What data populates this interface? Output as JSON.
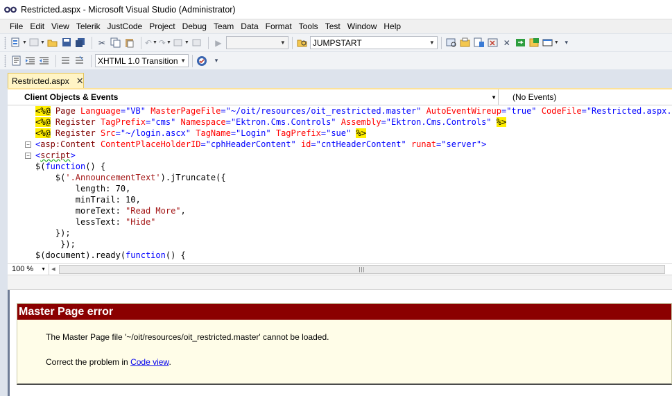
{
  "window": {
    "title": "Restricted.aspx - Microsoft Visual Studio (Administrator)"
  },
  "menu": [
    "File",
    "Edit",
    "View",
    "Telerik",
    "JustCode",
    "Project",
    "Debug",
    "Team",
    "Data",
    "Format",
    "Tools",
    "Test",
    "Window",
    "Help"
  ],
  "toolbar1": {
    "config_combo": "",
    "find_combo": "JUMPSTART",
    "icons": [
      "new-project-icon",
      "add-item-icon",
      "open-file-icon",
      "save-icon",
      "save-all-icon",
      "cut-icon",
      "copy-icon",
      "paste-icon",
      "undo-icon",
      "redo-icon",
      "navigate-back-icon",
      "navigate-forward-icon",
      "start-debugging-icon",
      "find-in-files-icon",
      "solution-explorer-icon",
      "properties-icon",
      "object-browser-icon",
      "toolbox-icon",
      "start-page-icon",
      "extension-manager-icon",
      "command-window-icon"
    ]
  },
  "toolbar2": {
    "schema_combo": "XHTML 1.0 Transition",
    "icons": [
      "format-selection-icon",
      "indent-icon",
      "outdent-icon",
      "comment-icon",
      "uncomment-icon",
      "check-accessibility-icon"
    ]
  },
  "tab": {
    "label": "Restricted.aspx"
  },
  "navbar": {
    "objects": "Client Objects & Events",
    "events": "(No Events)"
  },
  "code_lines": [
    {
      "fold": "",
      "tokens": [
        {
          "t": "<%@",
          "c": "hl"
        },
        {
          "t": " Page ",
          "c": "k-maroon"
        },
        {
          "t": "Language",
          "c": "k-red"
        },
        {
          "t": "=",
          "c": "k-blue"
        },
        {
          "t": "\"VB\"",
          "c": "k-blue"
        },
        {
          "t": " MasterPageFile",
          "c": "k-red"
        },
        {
          "t": "=",
          "c": "k-blue"
        },
        {
          "t": "\"~/oit/resources/oit_restricted.master\"",
          "c": "k-blue"
        },
        {
          "t": " AutoEventWireup",
          "c": "k-red"
        },
        {
          "t": "=",
          "c": "k-blue"
        },
        {
          "t": "\"true\"",
          "c": "k-blue"
        },
        {
          "t": " CodeFile",
          "c": "k-red"
        },
        {
          "t": "=",
          "c": "k-blue"
        },
        {
          "t": "\"Restricted.aspx.vb\"",
          "c": "k-blue"
        }
      ]
    },
    {
      "fold": "",
      "tokens": [
        {
          "t": "<%@",
          "c": "hl"
        },
        {
          "t": " Register ",
          "c": "k-maroon"
        },
        {
          "t": "TagPrefix",
          "c": "k-red"
        },
        {
          "t": "=",
          "c": "k-blue"
        },
        {
          "t": "\"cms\"",
          "c": "k-blue"
        },
        {
          "t": " Namespace",
          "c": "k-red"
        },
        {
          "t": "=",
          "c": "k-blue"
        },
        {
          "t": "\"Ektron.Cms.Controls\"",
          "c": "k-blue"
        },
        {
          "t": " Assembly",
          "c": "k-red"
        },
        {
          "t": "=",
          "c": "k-blue"
        },
        {
          "t": "\"Ektron.Cms.Controls\"",
          "c": "k-blue"
        },
        {
          "t": " ",
          "c": ""
        },
        {
          "t": "%>",
          "c": "hl"
        }
      ]
    },
    {
      "fold": "",
      "tokens": [
        {
          "t": "<%@",
          "c": "hl"
        },
        {
          "t": " Register ",
          "c": "k-maroon"
        },
        {
          "t": "Src",
          "c": "k-red"
        },
        {
          "t": "=",
          "c": "k-blue"
        },
        {
          "t": "\"~/login.ascx\"",
          "c": "k-blue"
        },
        {
          "t": " TagName",
          "c": "k-red"
        },
        {
          "t": "=",
          "c": "k-blue"
        },
        {
          "t": "\"Login\"",
          "c": "k-blue"
        },
        {
          "t": " TagPrefix",
          "c": "k-red"
        },
        {
          "t": "=",
          "c": "k-blue"
        },
        {
          "t": "\"sue\"",
          "c": "k-blue"
        },
        {
          "t": " ",
          "c": ""
        },
        {
          "t": "%>",
          "c": "hl"
        }
      ]
    },
    {
      "fold": "−",
      "tokens": [
        {
          "t": "<",
          "c": "k-blue"
        },
        {
          "t": "asp:Content",
          "c": "k-maroon"
        },
        {
          "t": " ContentPlaceHolderID",
          "c": "k-red"
        },
        {
          "t": "=",
          "c": "k-blue"
        },
        {
          "t": "\"cphHeaderContent\"",
          "c": "k-blue"
        },
        {
          "t": " id",
          "c": "k-red"
        },
        {
          "t": "=",
          "c": "k-blue"
        },
        {
          "t": "\"cntHeaderContent\"",
          "c": "k-blue"
        },
        {
          "t": " runat",
          "c": "k-red"
        },
        {
          "t": "=",
          "c": "k-blue"
        },
        {
          "t": "\"server\"",
          "c": "k-blue"
        },
        {
          "t": ">",
          "c": "k-blue"
        }
      ]
    },
    {
      "fold": "−",
      "tokens": [
        {
          "t": "<",
          "c": "k-blue"
        },
        {
          "t": "script",
          "c": "k-maroon squig"
        },
        {
          "t": ">",
          "c": "k-blue"
        }
      ]
    },
    {
      "fold": "",
      "tokens": [
        {
          "t": "$(",
          "c": ""
        },
        {
          "t": "function",
          "c": "k-blue"
        },
        {
          "t": "() {",
          "c": ""
        }
      ]
    },
    {
      "fold": "",
      "tokens": [
        {
          "t": "    $(",
          "c": ""
        },
        {
          "t": "'.AnnouncementText'",
          "c": "k-green"
        },
        {
          "t": ").jTruncate({",
          "c": ""
        }
      ]
    },
    {
      "fold": "",
      "tokens": [
        {
          "t": "        length: 70,",
          "c": ""
        }
      ]
    },
    {
      "fold": "",
      "tokens": [
        {
          "t": "        minTrail: 10,",
          "c": ""
        }
      ]
    },
    {
      "fold": "",
      "tokens": [
        {
          "t": "        moreText: ",
          "c": ""
        },
        {
          "t": "\"Read More\"",
          "c": "k-green"
        },
        {
          "t": ",",
          "c": ""
        }
      ]
    },
    {
      "fold": "",
      "tokens": [
        {
          "t": "        lessText: ",
          "c": ""
        },
        {
          "t": "\"Hide\"",
          "c": "k-green"
        }
      ]
    },
    {
      "fold": "",
      "tokens": [
        {
          "t": "    });",
          "c": ""
        }
      ]
    },
    {
      "fold": "",
      "tokens": [
        {
          "t": "     });",
          "c": ""
        }
      ]
    },
    {
      "fold": "",
      "tokens": [
        {
          "t": "$(document).ready(",
          "c": ""
        },
        {
          "t": "function",
          "c": "k-blue"
        },
        {
          "t": "() {",
          "c": ""
        }
      ]
    }
  ],
  "editor_status": {
    "zoom": "100 %"
  },
  "error_panel": {
    "title": "Master Page error",
    "message": "The Master Page file '~/oit/resources/oit_restricted.master' cannot be loaded.",
    "fix_prefix": "Correct the problem in ",
    "fix_link": "Code view",
    "fix_suffix": "."
  },
  "colors": {
    "error_header": "#8b0000",
    "tab_active": "#fff4c5",
    "highlight": "#ffee00"
  }
}
